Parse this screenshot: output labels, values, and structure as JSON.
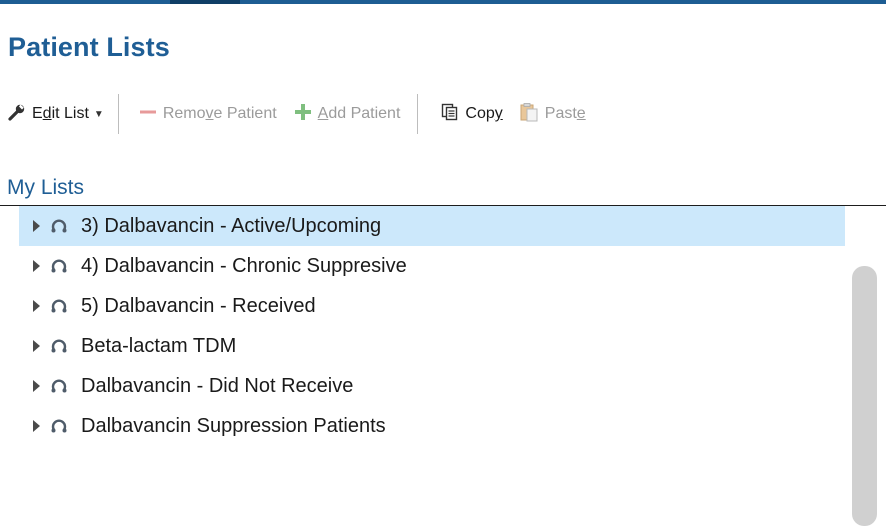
{
  "page": {
    "title": "Patient Lists"
  },
  "toolbar": {
    "edit_list": {
      "pre": "E",
      "underline": "d",
      "post": "it List",
      "icon": "wrench-icon"
    },
    "remove_patient": {
      "pre": "Remo",
      "underline": "v",
      "post": "e Patient",
      "icon": "minus-icon"
    },
    "add_patient": {
      "pre": "",
      "underline": "A",
      "post": "dd Patient",
      "icon": "plus-icon"
    },
    "copy": {
      "pre": "Cop",
      "underline": "y",
      "post": "",
      "icon": "copy-icon"
    },
    "paste": {
      "pre": "Past",
      "underline": "e",
      "post": "",
      "icon": "paste-icon"
    }
  },
  "section": {
    "title": "My Lists"
  },
  "lists": [
    {
      "label": "3) Dalbavancin - Active/Upcoming",
      "selected": true
    },
    {
      "label": "4) Dalbavancin - Chronic Suppresive",
      "selected": false
    },
    {
      "label": "5) Dalbavancin - Received",
      "selected": false
    },
    {
      "label": "Beta-lactam TDM",
      "selected": false
    },
    {
      "label": "Dalbavancin - Did Not Receive",
      "selected": false
    },
    {
      "label": "Dalbavancin Suppression Patients",
      "selected": false
    }
  ],
  "colors": {
    "accent": "#1f5e95",
    "selection": "#cce8fb",
    "disabled_text": "#9b9b9b",
    "add_icon": "#7fbf7f",
    "remove_icon": "#e79a9a"
  }
}
